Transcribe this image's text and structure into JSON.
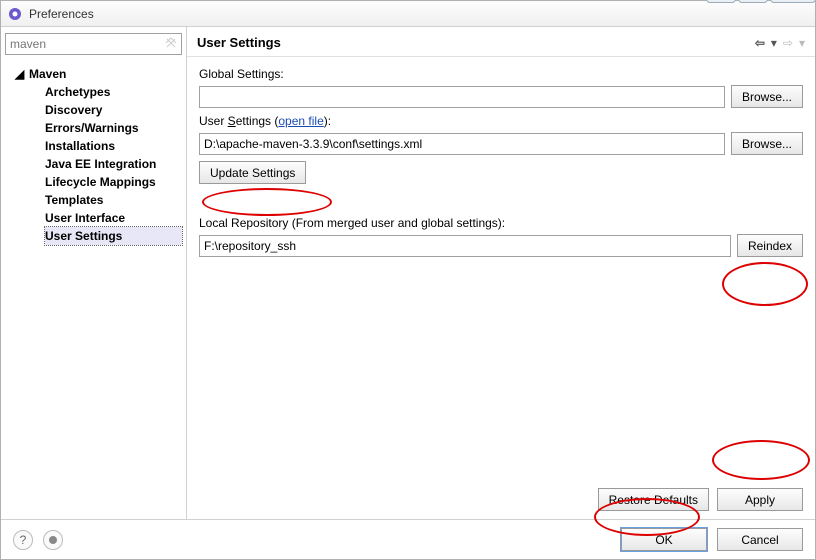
{
  "window": {
    "title": "Preferences"
  },
  "search": {
    "value": "maven"
  },
  "tree": {
    "root": "Maven",
    "items": [
      "Archetypes",
      "Discovery",
      "Errors/Warnings",
      "Installations",
      "Java EE Integration",
      "Lifecycle Mappings",
      "Templates",
      "User Interface",
      "User Settings"
    ],
    "selected_index": 8
  },
  "page": {
    "title": "User Settings",
    "global_settings_label": "Global Settings:",
    "global_settings_value": "",
    "browse_label": "Browse...",
    "user_settings_label_pre": "User ",
    "user_settings_label_ul": "S",
    "user_settings_label_post": "ettings (",
    "open_file_link": "open file",
    "user_settings_label_end": "):",
    "user_settings_value": "D:\\apache-maven-3.3.9\\conf\\settings.xml",
    "update_settings_label": "Update Settings",
    "local_repo_label": "Local Repository (From merged user and global settings):",
    "local_repo_value": "F:\\repository_ssh",
    "reindex_label": "Reindex",
    "restore_defaults_label": "Restore Defaults",
    "apply_label": "Apply",
    "ok_label": "OK",
    "cancel_label": "Cancel"
  }
}
